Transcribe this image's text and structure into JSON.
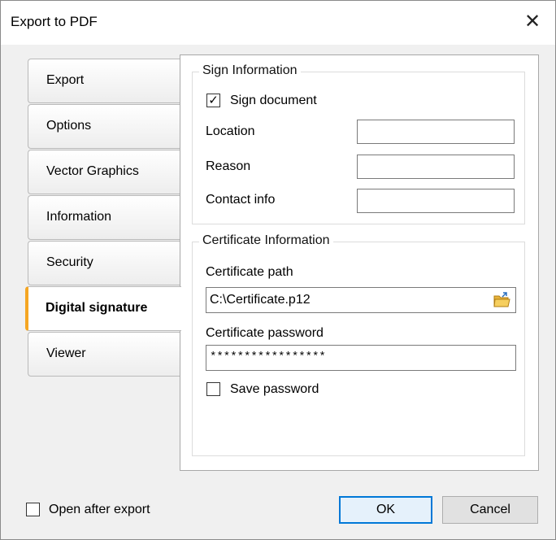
{
  "window": {
    "title": "Export to PDF",
    "close_glyph": "✕"
  },
  "tabs": [
    {
      "label": "Export"
    },
    {
      "label": "Options"
    },
    {
      "label": "Vector Graphics"
    },
    {
      "label": "Information"
    },
    {
      "label": "Security"
    },
    {
      "label": "Digital signature",
      "active": true
    },
    {
      "label": "Viewer"
    }
  ],
  "sign_info": {
    "group_title": "Sign Information",
    "sign_document_label": "Sign document",
    "sign_document_checked": true,
    "location_label": "Location",
    "location_value": "",
    "reason_label": "Reason",
    "reason_value": "",
    "contact_label": "Contact info",
    "contact_value": ""
  },
  "certificate": {
    "group_title": "Certificate Information",
    "path_label": "Certificate path",
    "path_value": "C:\\Certificate.p12",
    "password_label": "Certificate password",
    "password_value": "*****************",
    "save_password_label": "Save password",
    "save_password_checked": false
  },
  "footer": {
    "open_after_export_label": "Open after export",
    "open_after_export_checked": false,
    "ok_label": "OK",
    "cancel_label": "Cancel"
  },
  "colors": {
    "active_tab_accent": "#f5a623",
    "primary_button_border": "#0078d7"
  },
  "check_glyph": "✓"
}
